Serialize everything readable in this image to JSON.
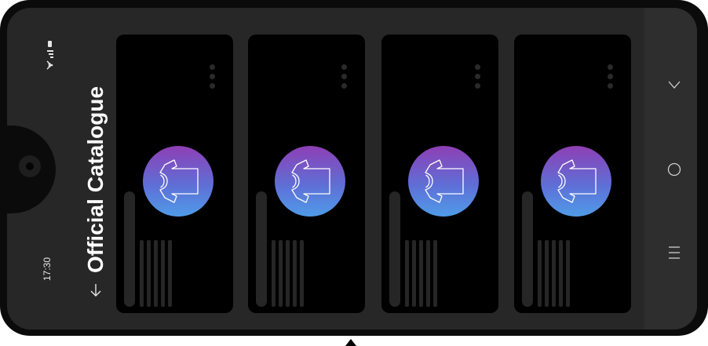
{
  "status_bar": {
    "time": "17:30",
    "icons": [
      "wifi-icon",
      "signal-icon",
      "battery-icon"
    ]
  },
  "header": {
    "title": "Official Catalogue",
    "sort_icon": "arrow-down-icon"
  },
  "catalogue": {
    "items": [
      {
        "icon": "tshirt-icon",
        "menu_icon": "more-vertical-icon"
      },
      {
        "icon": "tshirt-icon",
        "menu_icon": "more-vertical-icon"
      },
      {
        "icon": "tshirt-icon",
        "menu_icon": "more-vertical-icon"
      },
      {
        "icon": "tshirt-icon",
        "menu_icon": "more-vertical-icon"
      }
    ],
    "thumb_gradient": [
      "#8e3fb4",
      "#4f9ce8"
    ]
  },
  "nav_bar": {
    "buttons": [
      "back-chevron-icon",
      "home-circle-icon",
      "recents-menu-icon"
    ]
  },
  "colors": {
    "device_frame": "#0b0b0b",
    "screen_background": "#272727",
    "card_background": "#000000"
  }
}
